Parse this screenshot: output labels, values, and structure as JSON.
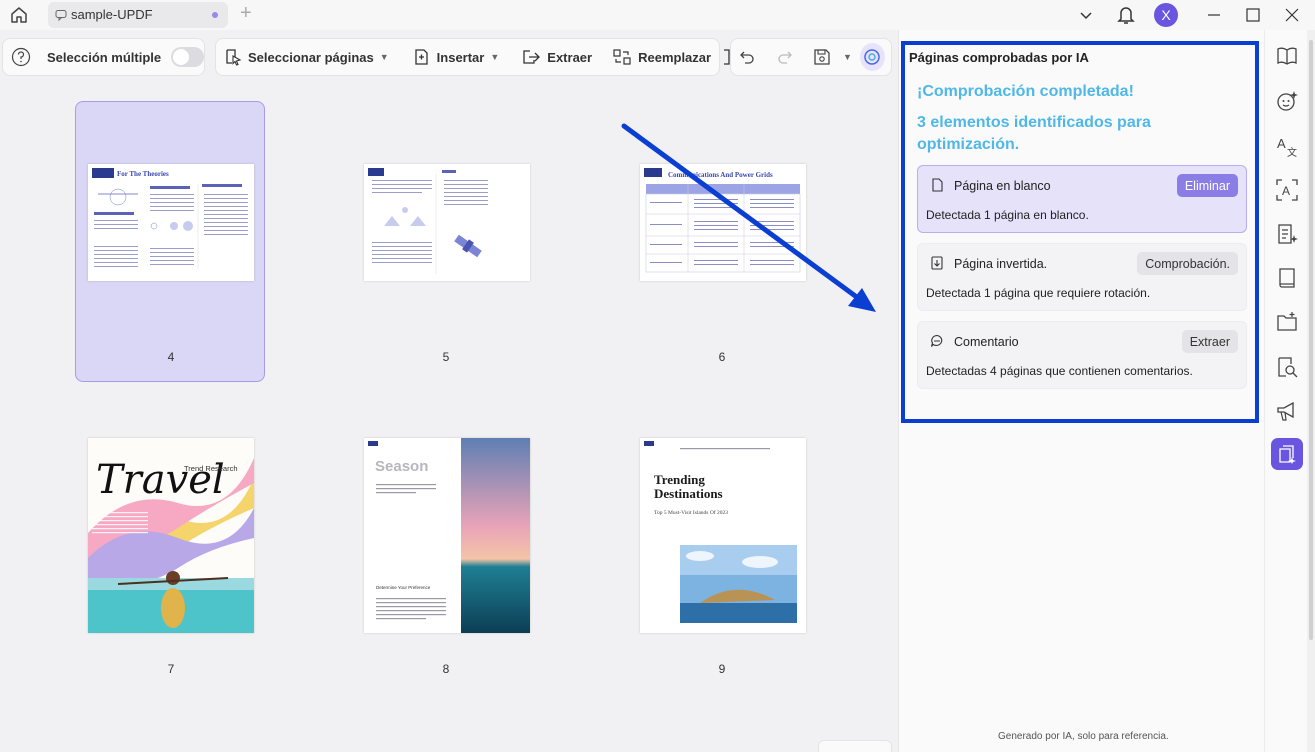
{
  "window": {
    "tab_title": "sample-UPDF",
    "avatar_letter": "X"
  },
  "toolbar": {
    "multi_select_label": "Selección múltiple",
    "select_pages_label": "Seleccionar páginas",
    "insert_label": "Insertar",
    "extract_label": "Extraer",
    "replace_label": "Reemplazar"
  },
  "pages": [
    {
      "number": "4",
      "selected": true,
      "title": "For The Theories"
    },
    {
      "number": "5",
      "selected": false
    },
    {
      "number": "6",
      "selected": false,
      "title": "Communications And Power Grids"
    },
    {
      "number": "7",
      "selected": false,
      "title": "Travel",
      "subtitle": "Trend Research"
    },
    {
      "number": "8",
      "selected": false,
      "title": "Season",
      "subtitle": "Determine Your Preference"
    },
    {
      "number": "9",
      "selected": false,
      "title": "Trending Destinations",
      "subtitle": "Top 5 Must-Visit Islands Of 2023"
    }
  ],
  "panel": {
    "header": "Páginas comprobadas por IA",
    "status_complete": "¡Comprobación completada!",
    "status_summary": "3 elementos identificados para optimización.",
    "cards": [
      {
        "title": "Página en blanco",
        "button": "Eliminar",
        "description": "Detectada 1 página en blanco.",
        "icon": "page-icon"
      },
      {
        "title": "Página invertida.",
        "button": "Comprobación.",
        "description": "Detectada 1 página que requiere rotación.",
        "icon": "rotate-page-icon"
      },
      {
        "title": "Comentario",
        "button": "Extraer",
        "description": "Detectadas 4 páginas que contienen comentarios.",
        "icon": "comment-icon"
      }
    ],
    "footnote": "Generado por IA, solo para referencia."
  },
  "colors": {
    "accent": "#6a55e0",
    "highlight_border": "#0b3fd1",
    "status_text": "#4fb8e6",
    "annotation_arrow": "#0b3fd1"
  }
}
